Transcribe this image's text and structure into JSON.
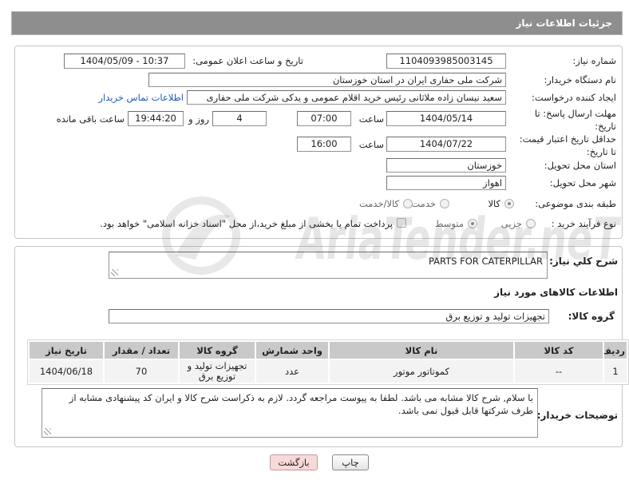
{
  "colors": {
    "header_bg": "#8e8e8e",
    "link": "#1a5bb8",
    "back_button_bg": "#f8d9d9",
    "table_header_bg": "#c9c9c9"
  },
  "watermark": "AriaTender.neT",
  "header": {
    "title": "جزئیات اطلاعات نیاز"
  },
  "details": {
    "need_number": {
      "label": "شماره نیاز:",
      "value": "1104093985003145"
    },
    "announce_datetime": {
      "label": "تاریخ و ساعت اعلان عمومی:",
      "value": "1404/05/09 - 10:37"
    },
    "buyer_org": {
      "label": "نام دستگاه خریدار:",
      "value": "شرکت ملی حفاری ایران در استان خوزستان"
    },
    "requester": {
      "label": "ایجاد کننده درخواست:",
      "value": "سعید نیسان زاده ملاثانی رئیس خرید اقلام عمومی و یدکی شرکت ملی حفاری",
      "contact_link": "اطلاعات تماس خریدار"
    },
    "response_deadline": {
      "label_line1": "مهلت ارسال پاسخ: تا",
      "label_line2": "تاریخ:",
      "date": "1404/05/14",
      "time_label": "ساعت",
      "time": "07:00",
      "days": "4",
      "days_label": "روز و",
      "remaining": "19:44:20",
      "remaining_label": "ساعت باقی مانده"
    },
    "price_validity": {
      "label_line1": "حداقل تاریخ اعتبار قیمت:",
      "label_line2": "تا تاریخ:",
      "date": "1404/07/22",
      "time_label": "ساعت",
      "time": "16:00"
    },
    "delivery_province": {
      "label": "استان محل تحویل:",
      "value": "خوزستان"
    },
    "delivery_city": {
      "label": "شهر محل تحویل:",
      "value": "اهواز"
    },
    "category": {
      "label": "طبقه بندی موضوعی:",
      "options": [
        {
          "label": "کالا",
          "selected": true
        },
        {
          "label": "خدمت",
          "selected": false
        },
        {
          "label": "کالا/خدمت",
          "selected": false
        }
      ]
    },
    "process_type": {
      "label": "نوع فرآیند خرید :",
      "options": [
        {
          "label": "جزیی",
          "selected": false
        },
        {
          "label": "متوسط",
          "selected": true
        }
      ],
      "treasury": {
        "label": "پرداخت تمام یا بخشی از مبلغ خرید،از محل \"اسناد خزانه اسلامی\" خواهد بود.",
        "checked": false
      }
    }
  },
  "need_summary": {
    "label": "شرح کلي نياز:",
    "value": "PARTS FOR CATERPILLAR"
  },
  "items": {
    "title": "اطلاعات کالاهای مورد نیاز",
    "group_label": "گروه کالا:",
    "group_value": "تجهیزات تولید و توزیع برق",
    "columns": [
      "ردیف",
      "کد کالا",
      "نام کالا",
      "واحد شمارش",
      "گروه کالا",
      "تعداد / مقدار",
      "تاریخ نیاز"
    ],
    "rows": [
      {
        "row": "1",
        "code": "--",
        "name": "کموتاتور موتور",
        "unit": "عدد",
        "group": "تجهیزات تولید و توزیع برق",
        "quantity": "70",
        "need_date": "1404/06/18"
      }
    ]
  },
  "buyer_notes": {
    "label": "توضیحات خریدار:",
    "value": "با سلام, شرح کالا مشابه می باشد. لطفا به پیوست مراجعه گردد. لازم به ذکراست شرح کالا و ایران کد  پیشنهادی مشابه از طرف شرکتها قابل قبول نمی باشد."
  },
  "buttons": {
    "print": "چاپ",
    "back": "بازگشت"
  }
}
